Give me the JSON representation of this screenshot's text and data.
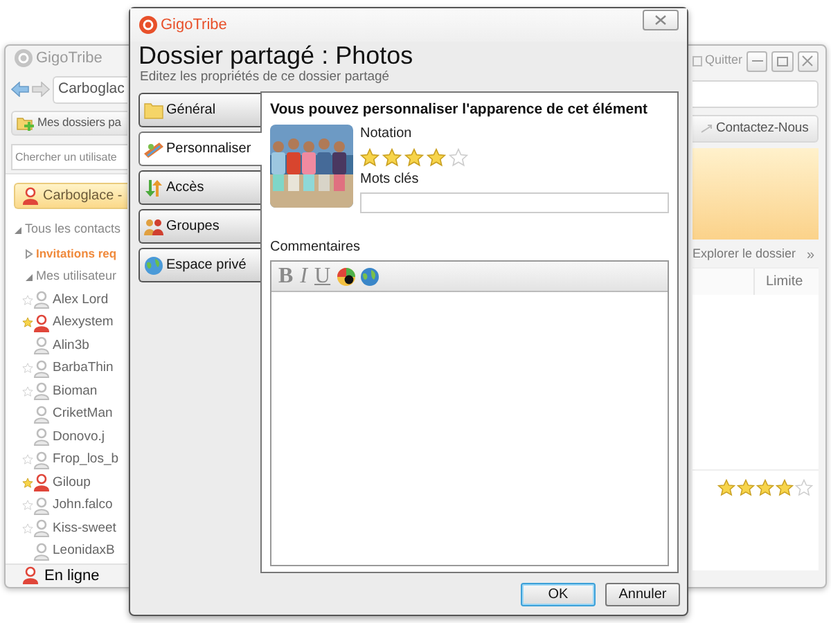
{
  "background_window": {
    "logo": "GigoTribe",
    "quit_label": "Quitter",
    "address": "Carboglac",
    "folders_button": "Mes dossiers pa",
    "contact_button": "Contactez-Nous",
    "search": {
      "placeholder": "Chercher un utilisate"
    },
    "current_user": "Carboglace -",
    "tree": [
      {
        "label": "Tous les contacts",
        "expanded": true,
        "children": [
          {
            "label": "Invitations req",
            "expanded": false
          },
          {
            "label": "Mes utilisateur",
            "expanded": true,
            "children": [
              {
                "label": "Alex Lord",
                "kind": "unstarred",
                "online": false
              },
              {
                "label": "Alexystem",
                "kind": "starred",
                "online": true
              },
              {
                "label": "Alin3b",
                "kind": "plain",
                "online": false
              },
              {
                "label": "BarbaThin",
                "kind": "unstarred",
                "online": false
              },
              {
                "label": "Bioman",
                "kind": "unstarred",
                "online": false
              },
              {
                "label": "CriketMan",
                "kind": "plain",
                "online": false
              },
              {
                "label": "Donovo.j",
                "kind": "plain",
                "online": false
              },
              {
                "label": "Frop_los_b",
                "kind": "unstarred",
                "online": false
              },
              {
                "label": "Giloup",
                "kind": "starred",
                "online": true
              },
              {
                "label": "John.falco",
                "kind": "unstarred",
                "online": false
              },
              {
                "label": "Kiss-sweet",
                "kind": "unstarred",
                "online": false
              },
              {
                "label": "LeonidaxB",
                "kind": "plain",
                "online": false
              }
            ]
          }
        ]
      }
    ],
    "status": "En ligne",
    "explore_label": "Explorer le dossier",
    "more": "»",
    "column": "Limite",
    "file_row": {
      "stars": 4
    }
  },
  "dialog": {
    "logo": "GigoTribe",
    "title": "Dossier partagé : Photos",
    "subtitle": "Editez les propriétés de ce dossier partagé",
    "tabs": [
      {
        "label": "Général",
        "selected": false
      },
      {
        "label": "Personnaliser",
        "selected": true
      },
      {
        "label": "Accès",
        "selected": false
      },
      {
        "label": "Groupes",
        "selected": false
      },
      {
        "label": "Espace privé",
        "selected": false
      }
    ],
    "heading": "Vous pouvez personnaliser l'apparence de cet élément",
    "rating_label": "Notation",
    "stars": 4,
    "keywords_label": "Mots clés",
    "comments_label": "Commentaires",
    "format_buttons": [
      "B",
      "I",
      "U"
    ],
    "buttons": [
      {
        "label": "OK",
        "default": true
      },
      {
        "label": "Annuler",
        "default": false
      }
    ]
  }
}
